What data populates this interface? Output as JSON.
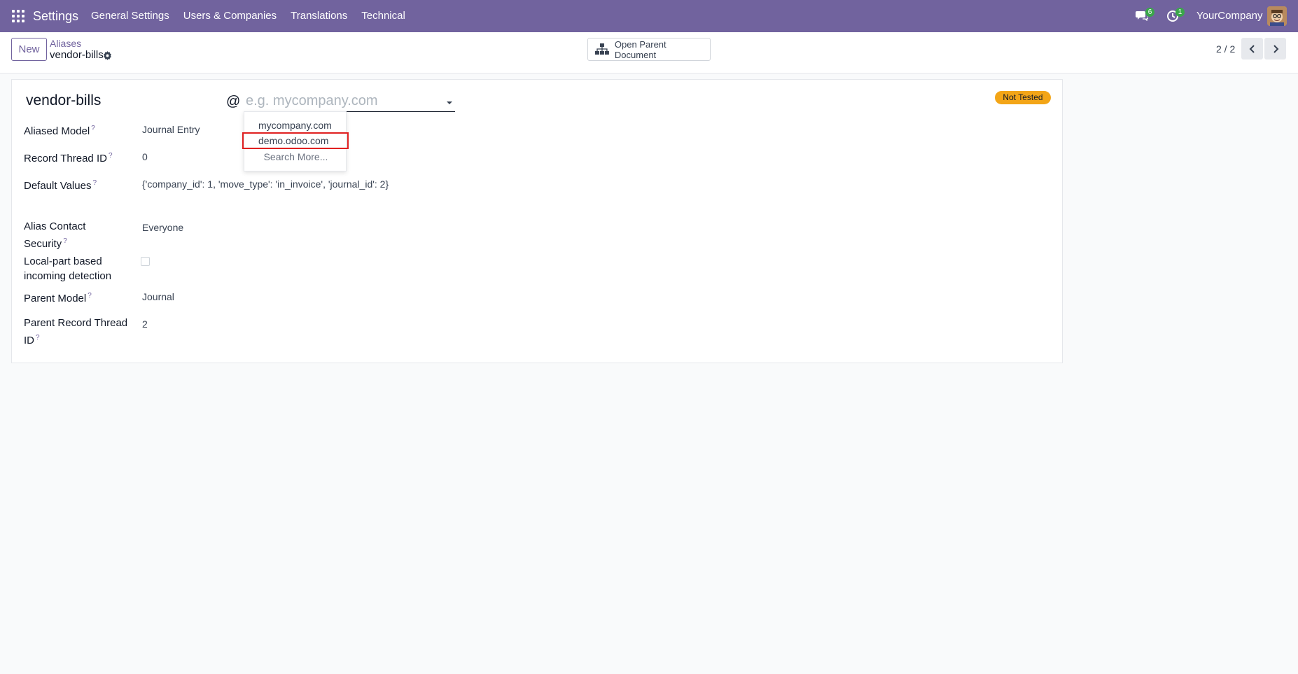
{
  "navbar": {
    "app_title": "Settings",
    "menu": [
      "General Settings",
      "Users & Companies",
      "Translations",
      "Technical"
    ],
    "messages_count": "6",
    "activities_count": "1",
    "company": "YourCompany",
    "color": "#71639e"
  },
  "control_panel": {
    "new_label": "New",
    "breadcrumb_parent": "Aliases",
    "breadcrumb_current": "vendor-bills",
    "open_parent_label": "Open Parent Document",
    "pager": "2 / 2"
  },
  "form": {
    "alias_name": "vendor-bills",
    "at": "@",
    "domain_placeholder": "e.g. mycompany.com",
    "status": "Not Tested",
    "fields": {
      "aliased_model_label": "Aliased Model",
      "aliased_model_value": "Journal Entry",
      "record_thread_label": "Record Thread ID",
      "record_thread_value": "0",
      "default_values_label": "Default Values",
      "default_values_value": "{'company_id': 1, 'move_type': 'in_invoice', 'journal_id': 2}",
      "contact_security_label_1": "Alias Contact",
      "contact_security_label_2": "Security",
      "contact_security_value": "Everyone",
      "local_part_label_1": "Local-part based",
      "local_part_label_2": "incoming detection",
      "parent_model_label": "Parent Model",
      "parent_model_value": "Journal",
      "parent_record_label_1": "Parent Record Thread",
      "parent_record_label_2": "ID",
      "parent_record_value": "2",
      "help": "?"
    }
  },
  "dropdown": {
    "options": [
      "mycompany.com",
      "demo.odoo.com"
    ],
    "search_more": "Search More..."
  }
}
